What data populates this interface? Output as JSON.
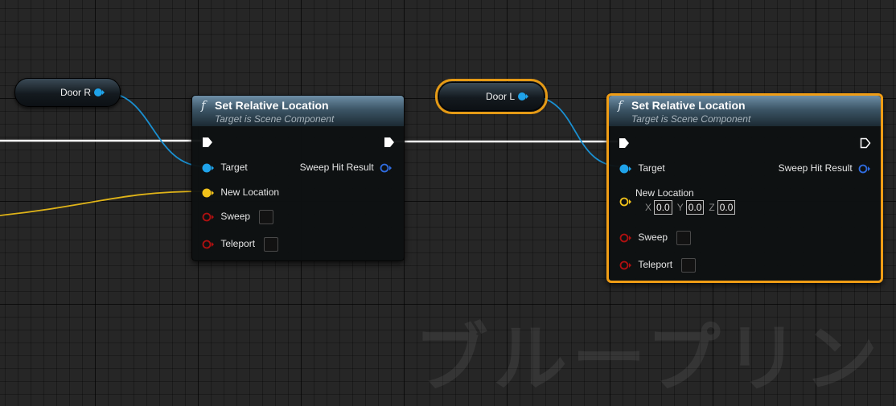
{
  "watermark": "ブループリント",
  "variables": {
    "door_r": "Door R",
    "door_l": "Door L"
  },
  "nodes": {
    "left": {
      "fn_icon": "f",
      "title": "Set Relative Location",
      "subtitle": "Target is Scene Component",
      "pins": {
        "target": "Target",
        "new_location": "New Location",
        "sweep": "Sweep",
        "teleport": "Teleport",
        "sweep_hit_result": "Sweep Hit Result"
      }
    },
    "right": {
      "fn_icon": "f",
      "title": "Set Relative Location",
      "subtitle": "Target is Scene Component",
      "pins": {
        "target": "Target",
        "new_location": "New Location",
        "sweep": "Sweep",
        "teleport": "Teleport",
        "sweep_hit_result": "Sweep Hit Result"
      },
      "vector": {
        "x_label": "X",
        "x": "0.0",
        "y_label": "Y",
        "y": "0.0",
        "z_label": "Z",
        "z": "0.0"
      }
    }
  },
  "colors": {
    "object_pin": "#1fa3ea",
    "vector_pin": "#f2c21a",
    "bool_pin": "#9a0f0f",
    "struct_pin": "#2356b8",
    "exec": "#ffffff",
    "selection": "#f09d15"
  }
}
